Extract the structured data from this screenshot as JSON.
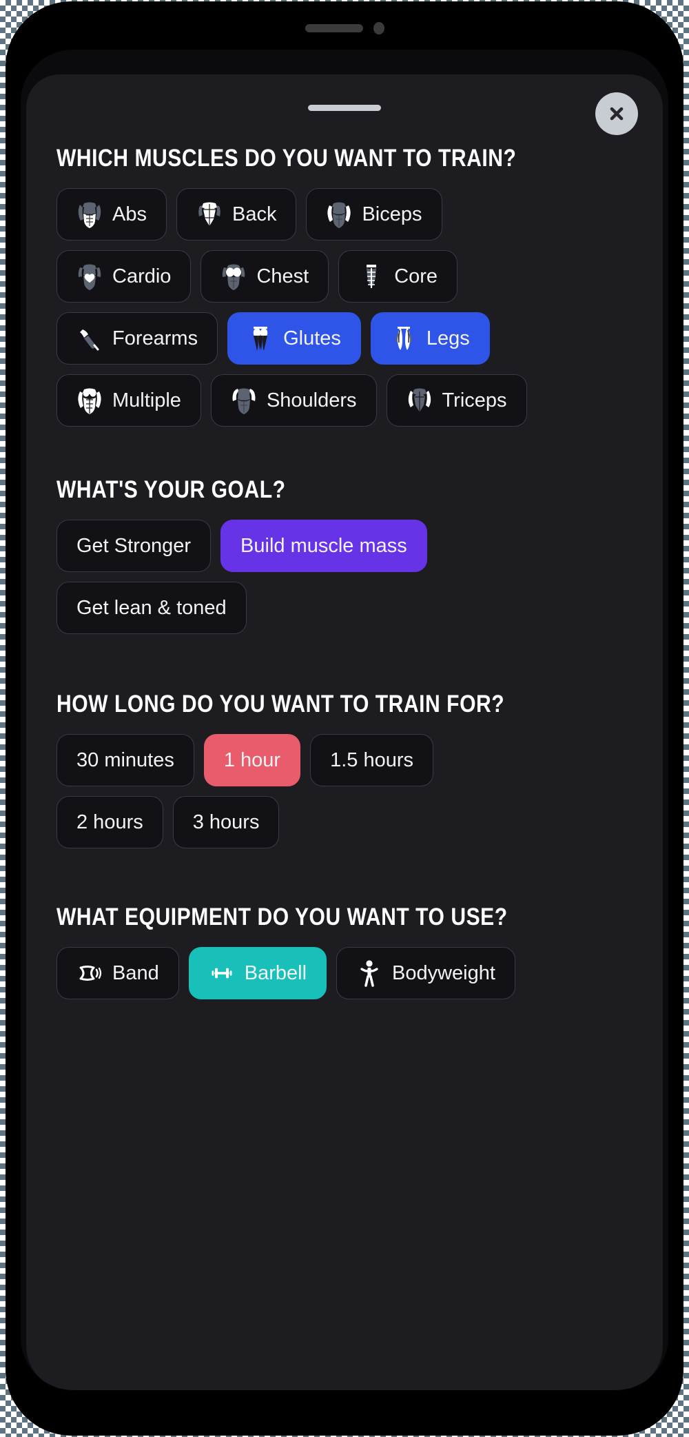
{
  "device": {
    "speaker_icon": "speaker-slot",
    "camera_icon": "camera-dot"
  },
  "sheet": {
    "grabber_icon": "drag-handle",
    "close_label": "×",
    "close_icon": "close-icon"
  },
  "sections": [
    {
      "id": "muscles",
      "title": "WHICH MUSCLES DO YOU WANT TO TRAIN?",
      "rows": [
        [
          {
            "label": "Abs",
            "icon": "muscle-abs-icon",
            "selected": false,
            "accent": ""
          },
          {
            "label": "Back",
            "icon": "muscle-back-icon",
            "selected": false,
            "accent": ""
          },
          {
            "label": "Biceps",
            "icon": "muscle-biceps-icon",
            "selected": false,
            "accent": ""
          }
        ],
        [
          {
            "label": "Cardio",
            "icon": "muscle-cardio-icon",
            "selected": false,
            "accent": ""
          },
          {
            "label": "Chest",
            "icon": "muscle-chest-icon",
            "selected": false,
            "accent": ""
          },
          {
            "label": "Core",
            "icon": "muscle-core-icon",
            "selected": false,
            "accent": ""
          }
        ],
        [
          {
            "label": "Forearms",
            "icon": "muscle-forearms-icon",
            "selected": false,
            "accent": ""
          },
          {
            "label": "Glutes",
            "icon": "muscle-glutes-icon",
            "selected": true,
            "accent": "blue"
          },
          {
            "label": "Legs",
            "icon": "muscle-legs-icon",
            "selected": true,
            "accent": "blue"
          }
        ],
        [
          {
            "label": "Multiple",
            "icon": "muscle-multiple-icon",
            "selected": false,
            "accent": ""
          },
          {
            "label": "Shoulders",
            "icon": "muscle-shoulders-icon",
            "selected": false,
            "accent": ""
          },
          {
            "label": "Triceps",
            "icon": "muscle-triceps-icon",
            "selected": false,
            "accent": ""
          }
        ]
      ]
    },
    {
      "id": "goal",
      "title": "WHAT'S YOUR GOAL?",
      "rows": [
        [
          {
            "label": "Get Stronger",
            "icon": "",
            "selected": false,
            "accent": ""
          },
          {
            "label": "Build muscle mass",
            "icon": "",
            "selected": true,
            "accent": "purple"
          }
        ],
        [
          {
            "label": "Get lean & toned",
            "icon": "",
            "selected": false,
            "accent": ""
          }
        ]
      ]
    },
    {
      "id": "duration",
      "title": "HOW LONG DO YOU WANT TO TRAIN FOR?",
      "rows": [
        [
          {
            "label": "30 minutes",
            "icon": "",
            "selected": false,
            "accent": ""
          },
          {
            "label": "1 hour",
            "icon": "",
            "selected": true,
            "accent": "red"
          },
          {
            "label": "1.5 hours",
            "icon": "",
            "selected": false,
            "accent": ""
          }
        ],
        [
          {
            "label": "2 hours",
            "icon": "",
            "selected": false,
            "accent": ""
          },
          {
            "label": "3 hours",
            "icon": "",
            "selected": false,
            "accent": ""
          }
        ]
      ]
    },
    {
      "id": "equipment",
      "title": "WHAT EQUIPMENT DO YOU WANT TO USE?",
      "rows": [
        [
          {
            "label": "Band",
            "icon": "equipment-band-icon",
            "selected": false,
            "accent": ""
          },
          {
            "label": "Barbell",
            "icon": "equipment-barbell-icon",
            "selected": true,
            "accent": "teal"
          },
          {
            "label": "Bodyweight",
            "icon": "equipment-bodyweight-icon",
            "selected": false,
            "accent": ""
          }
        ]
      ]
    }
  ],
  "colors": {
    "sheet_bg": "#1c1c21",
    "chip_bg": "#121216",
    "chip_border": "#3a3a42",
    "accent_blue": "#2f55e8",
    "accent_purple": "#6633e6",
    "accent_red": "#e85c6b",
    "accent_teal": "#19bfb9",
    "text": "#f2f3f5"
  }
}
